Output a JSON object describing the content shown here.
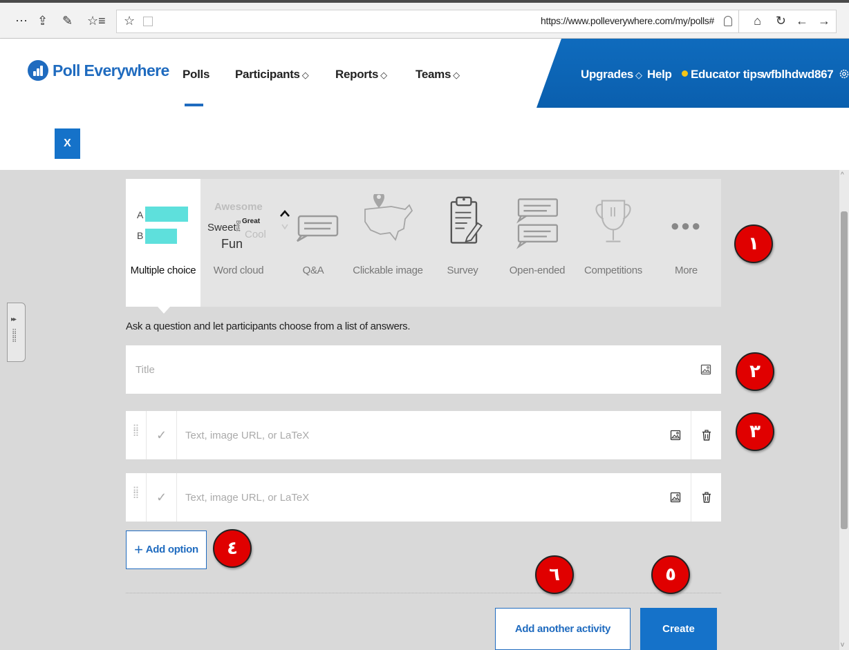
{
  "browser": {
    "url": "https://www.polleverywhere.com/my/polls#",
    "left_icons": [
      "more-icon",
      "share-icon",
      "pen-icon",
      "favorites-list-icon",
      "star-icon",
      "reading-view-icon"
    ],
    "right_icons": [
      "lock-icon",
      "home-icon",
      "refresh-icon",
      "back-icon",
      "forward-icon"
    ],
    "labels": {
      "more": "⋯",
      "share": "⇪",
      "pen": "✎",
      "favlist": "☆≡",
      "star": "☆",
      "home": "⌂",
      "refresh": "↻",
      "back": "←",
      "forward": "→",
      "lock": "🔒︎"
    }
  },
  "header": {
    "logo": "Poll Everywhere",
    "nav": [
      {
        "label": "Polls",
        "active": true
      },
      {
        "label": "Participants",
        "diamond": "💎︎"
      },
      {
        "label": "Reports",
        "diamond": "💎︎"
      },
      {
        "label": "Teams",
        "diamond": "💎︎"
      }
    ],
    "diamond_glyph": "◇",
    "right": {
      "upgrades": "Upgrades",
      "help": "Help",
      "educator_tips": "Educator tips",
      "username": "wfblhdwd867"
    }
  },
  "close_label": "X",
  "activity_types": [
    {
      "label": "Multiple choice",
      "selected": true
    },
    {
      "label": "Word cloud"
    },
    {
      "label": "Q&A"
    },
    {
      "label": "Clickable image"
    },
    {
      "label": "Survey"
    },
    {
      "label": "Open-ended"
    },
    {
      "label": "Competitions"
    },
    {
      "label": "More"
    }
  ],
  "mc_icon": {
    "a": "A",
    "b": "B"
  },
  "wordcloud_icon": {
    "w1": "Awesome",
    "w2": "Sweet",
    "w3": "Best",
    "w4": "Great",
    "w5": "Cool",
    "w6": "Fun"
  },
  "prompt": "Ask a question and let participants choose from a list of answers.",
  "title_placeholder": "Title",
  "options": [
    {
      "placeholder": "Text, image URL, or LaTeX"
    },
    {
      "placeholder": "Text, image URL, or LaTeX"
    }
  ],
  "add_option": "Add option",
  "add_another_activity": "Add another activity",
  "create": "Create",
  "callouts": [
    "١",
    "٢",
    "٣",
    "٤",
    "٥",
    "٦"
  ],
  "colors": {
    "brand_blue": "#1f6bbf",
    "callout_red": "#e00000",
    "teal_bar": "#5ee0dc"
  }
}
